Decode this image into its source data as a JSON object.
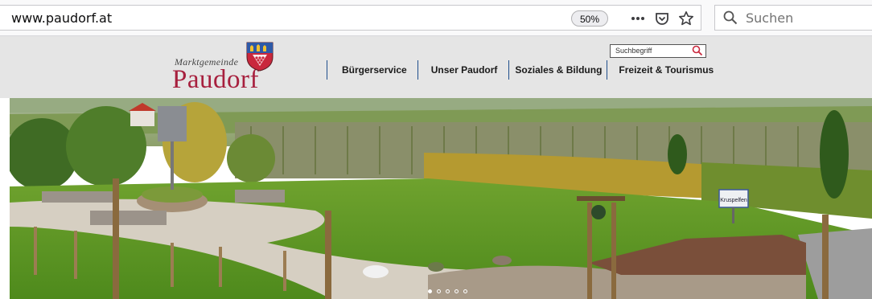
{
  "browser": {
    "url": "www.paudorf.at",
    "zoom": "50%",
    "search_placeholder": "Suchen",
    "icons": [
      "more-icon",
      "pocket-icon",
      "bookmark-star-icon",
      "search-icon"
    ]
  },
  "site": {
    "logo": {
      "small_text": "Marktgemeinde",
      "big_text": "Paudorf"
    },
    "nav": [
      {
        "label": "Bürgerservice"
      },
      {
        "label": "Unser Paudorf"
      },
      {
        "label": "Soziales & Bildung"
      },
      {
        "label": "Freizeit & Tourismus"
      }
    ],
    "search": {
      "placeholder": "Suchbegriff"
    },
    "hero": {
      "sign_text": "Kruspelfen",
      "slides": 5,
      "active_slide": 1
    },
    "colors": {
      "brand": "#a7203e",
      "header_bg": "#e5e5e5",
      "nav_separator": "#1f4e8c"
    }
  }
}
